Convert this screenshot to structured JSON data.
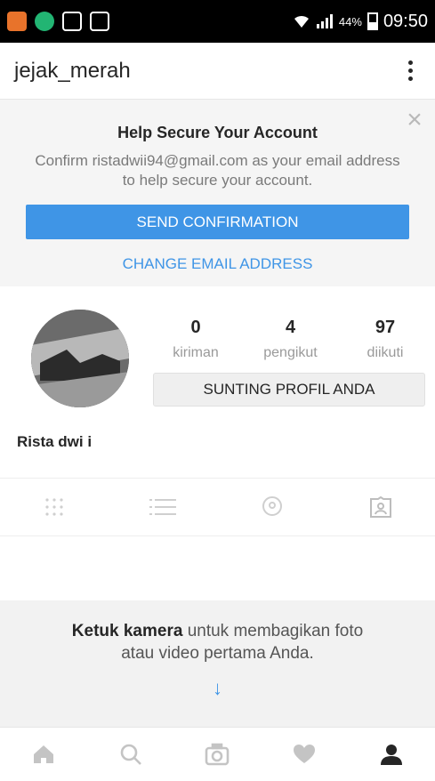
{
  "status_bar": {
    "battery_percent": "44%",
    "time": "09:50"
  },
  "header": {
    "username": "jejak_merah",
    "overflow_icon": "overflow-menu-icon"
  },
  "banner": {
    "close_icon": "close-icon",
    "close_glyph": "×",
    "title": "Help Secure Your Account",
    "body": "Confirm ristadwii94@gmail.com as your email address to help secure your account.",
    "send_button": "SEND CONFIRMATION",
    "change_link": "CHANGE EMAIL ADDRESS",
    "accent_color": "#3f95e6"
  },
  "profile": {
    "stats": [
      {
        "value": "0",
        "label": "kiriman"
      },
      {
        "value": "4",
        "label": "pengikut"
      },
      {
        "value": "97",
        "label": "diikuti"
      }
    ],
    "edit_button": "SUNTING PROFIL ANDA",
    "full_name": "Rista dwi i"
  },
  "tabs": [
    {
      "icon": "grid-icon"
    },
    {
      "icon": "list-icon"
    },
    {
      "icon": "location-pin-icon"
    },
    {
      "icon": "tagged-photos-icon"
    }
  ],
  "empty_state": {
    "cta_bold": "Ketuk kamera",
    "cta_rest": "untuk membagikan foto atau video pertama Anda.",
    "arrow_glyph": "↓"
  },
  "bottom_nav": [
    {
      "icon": "home-icon"
    },
    {
      "icon": "search-icon"
    },
    {
      "icon": "camera-icon"
    },
    {
      "icon": "heart-icon"
    },
    {
      "icon": "profile-icon"
    }
  ]
}
